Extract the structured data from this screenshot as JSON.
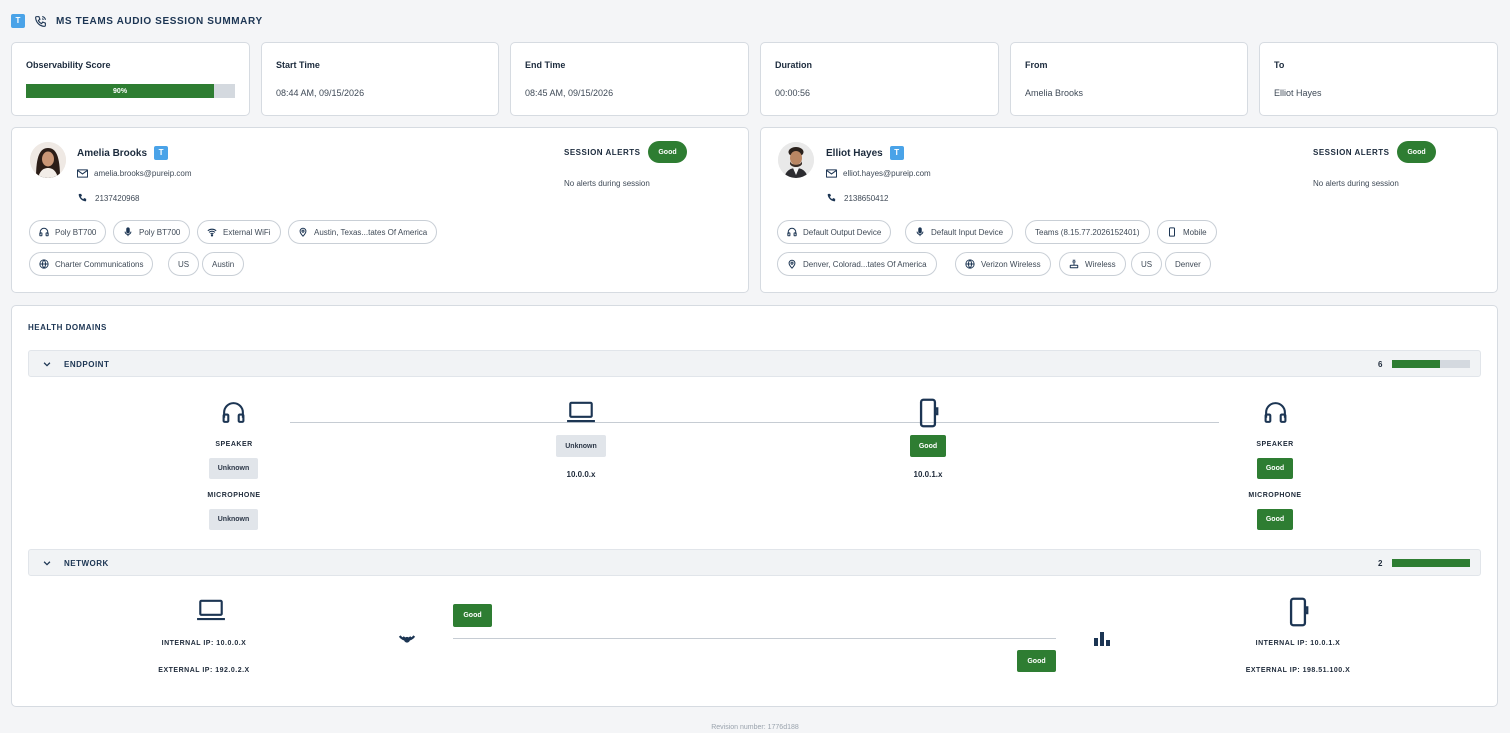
{
  "header": {
    "app_badge": "T",
    "title": "MS TEAMS AUDIO SESSION SUMMARY",
    "icon": "phone-call-icon"
  },
  "stats": {
    "observability": {
      "label": "Observability Score",
      "value": "90%",
      "score": 0.9
    },
    "start": {
      "label": "Start Time",
      "value": "08:44 AM, 09/15/2026"
    },
    "end": {
      "label": "End Time",
      "value": "08:45 AM, 09/15/2026"
    },
    "duration": {
      "label": "Duration",
      "value": "00:00:56"
    },
    "from": {
      "label": "From",
      "value": "Amelia Brooks"
    },
    "to": {
      "label": "To",
      "value": "Elliot Hayes"
    }
  },
  "participants": {
    "caller": {
      "name": "Amelia Brooks",
      "badge": "T",
      "email": "amelia.brooks@pureip.com",
      "phone": "2137420968",
      "alerts_label": "SESSION ALERTS",
      "alerts_status": "Good",
      "alerts_text": "No alerts during session",
      "chips_row1": [
        {
          "icon": "headphones-icon",
          "text": "Poly BT700"
        },
        {
          "icon": "microphone-icon",
          "text": "Poly BT700"
        },
        {
          "icon": "wifi-icon",
          "text": "External WiFi"
        },
        {
          "icon": "location-pin-icon",
          "text": "Austin, Texas...tates Of America"
        }
      ],
      "chips_row2": [
        {
          "icon": "globe-icon",
          "text": "Charter Communications"
        },
        {
          "icon": "",
          "text": "US"
        },
        {
          "icon": "",
          "text": "Austin"
        }
      ]
    },
    "callee": {
      "name": "Elliot Hayes",
      "badge": "T",
      "email": "elliot.hayes@pureip.com",
      "phone": "2138650412",
      "alerts_label": "SESSION ALERTS",
      "alerts_status": "Good",
      "alerts_text": "No alerts during session",
      "chips_row1": [
        {
          "icon": "headphones-icon",
          "text": "Default Output Device"
        },
        {
          "icon": "microphone-icon",
          "text": "Default Input Device"
        },
        {
          "icon": "",
          "text": "Teams (8.15.77.2026152401)"
        },
        {
          "icon": "mobile-icon",
          "text": "Mobile"
        }
      ],
      "chips_row2": [
        {
          "icon": "location-pin-icon",
          "text": "Denver, Colorad...tates Of America"
        },
        {
          "icon": "globe-icon",
          "text": "Verizon Wireless"
        },
        {
          "icon": "router-icon",
          "text": "Wireless"
        },
        {
          "icon": "",
          "text": "US"
        },
        {
          "icon": "",
          "text": "Denver"
        }
      ]
    }
  },
  "health": {
    "title": "HEALTH DOMAINS",
    "endpoint": {
      "title": "ENDPOINT",
      "count": "6",
      "fill": 0.62,
      "left_speaker_label": "SPEAKER",
      "left_speaker_status": "Unknown",
      "left_mic_label": "MICROPHONE",
      "left_mic_status": "Unknown",
      "laptop_status": "Unknown",
      "laptop_ip": "10.0.0.x",
      "mobile_status": "Good",
      "mobile_ip": "10.0.1.x",
      "right_speaker_label": "SPEAKER",
      "right_speaker_status": "Good",
      "right_mic_label": "MICROPHONE",
      "right_mic_status": "Good"
    },
    "network": {
      "title": "NETWORK",
      "count": "2",
      "fill": 1.0,
      "left_internal": "INTERNAL IP: 10.0.0.X",
      "left_external": "EXTERNAL IP: 192.0.2.X",
      "wifi_status": "Good",
      "cell_status": "Good",
      "right_internal": "INTERNAL IP: 10.0.1.X",
      "right_external": "EXTERNAL IP: 198.51.100.X"
    }
  },
  "footer": {
    "revision": "Revision number: 1776d188"
  },
  "colors": {
    "good": "#2e7d32",
    "accent": "#4aa3e8",
    "navy": "#1c3553"
  }
}
